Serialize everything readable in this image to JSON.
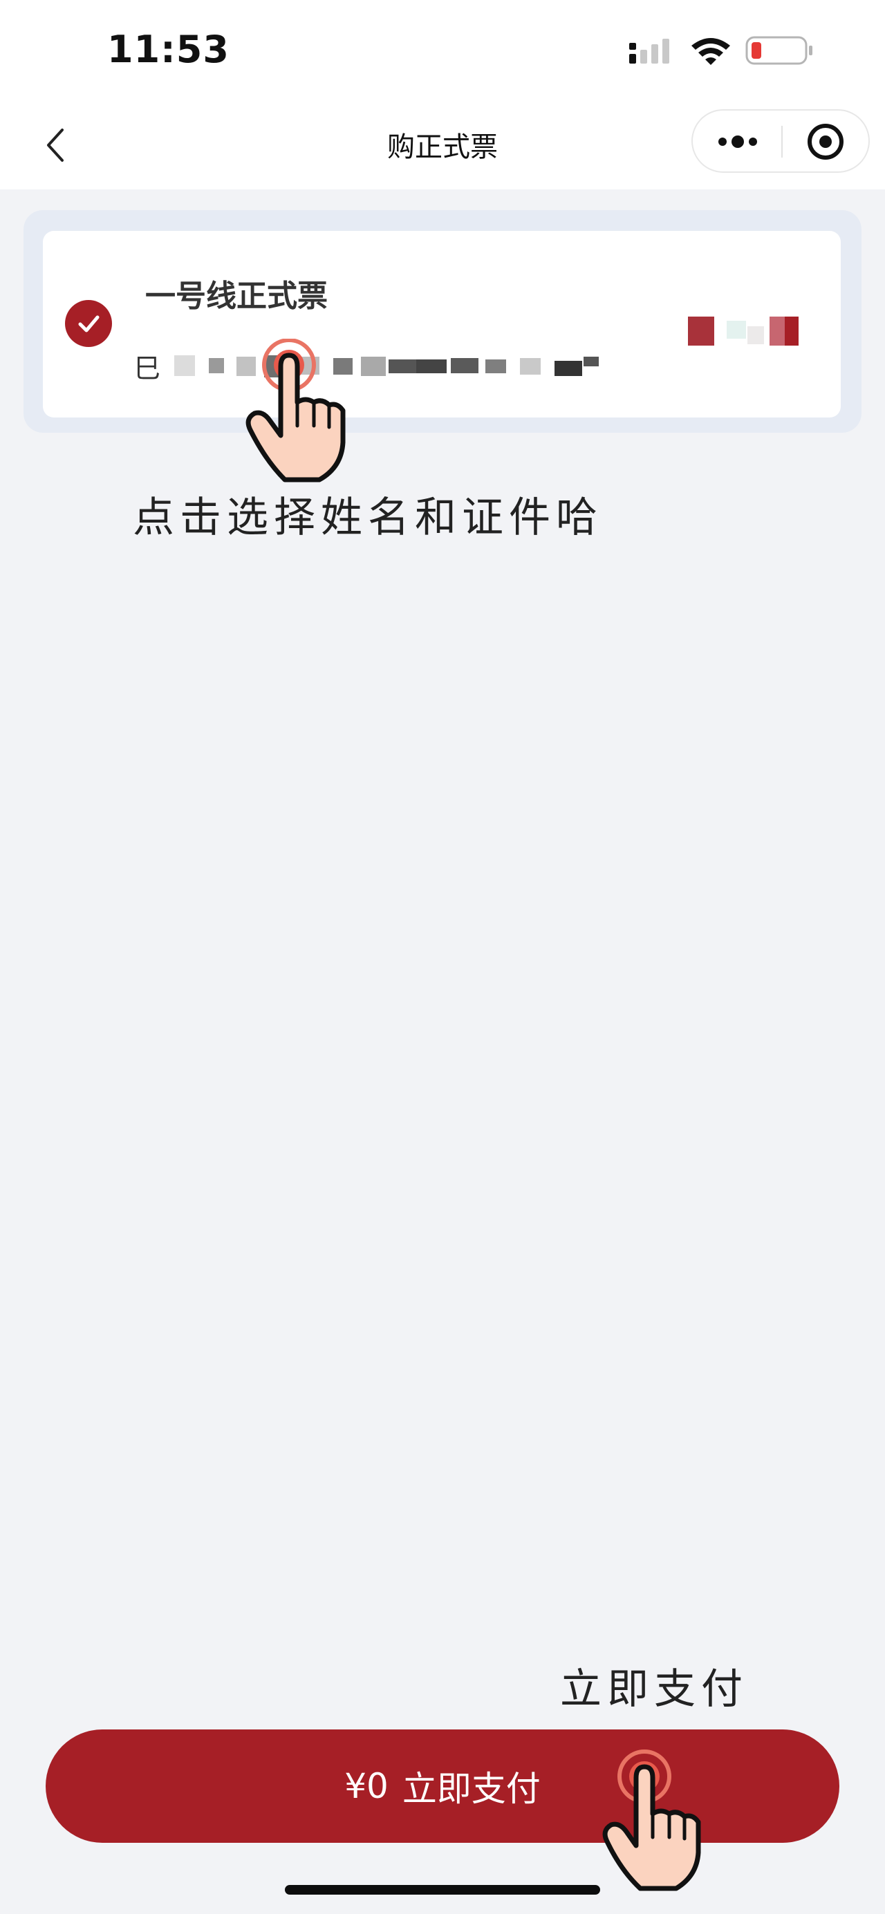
{
  "status_bar": {
    "time": "11:53"
  },
  "nav": {
    "title": "购正式票"
  },
  "ticket": {
    "name": "一号线正式票",
    "id_prefix": "巳",
    "selected": true
  },
  "annotations": {
    "select_hint": "点击选择姓名和证件哈",
    "pay_hint": "立即支付"
  },
  "footer": {
    "price": "¥0",
    "pay_label": "立即支付"
  },
  "icons": [
    "back-icon",
    "more-icon",
    "target-icon",
    "check-icon",
    "hand-pointer-icon",
    "signal-icon",
    "wifi-icon",
    "battery-icon"
  ],
  "colors": {
    "brand_red": "#a61f26",
    "background": "#f2f3f6",
    "battery_low": "#e53935"
  }
}
